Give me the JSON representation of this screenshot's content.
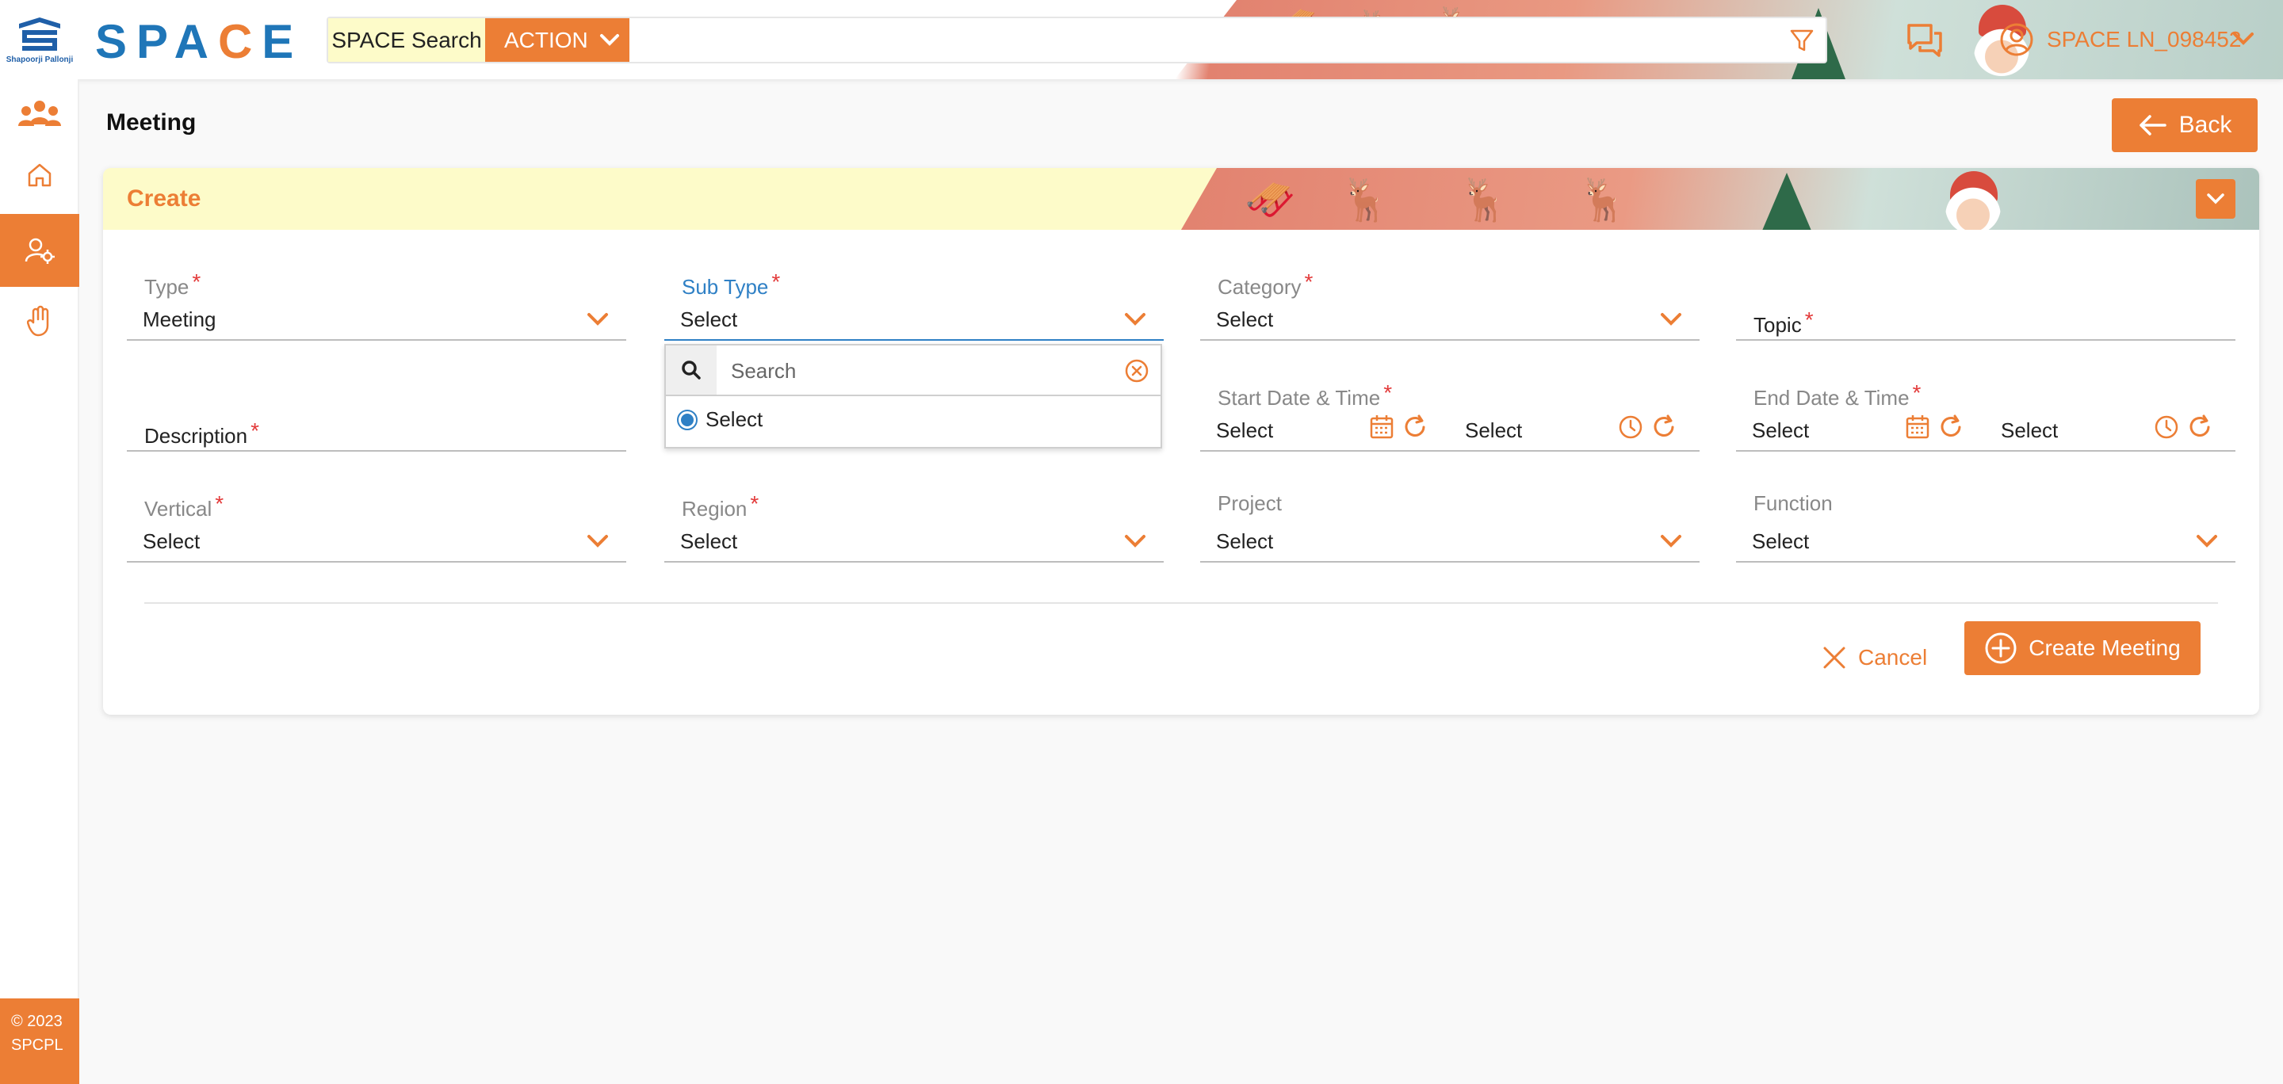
{
  "header": {
    "brand": "SPACE",
    "search_label": "SPACE Search",
    "action_label": "ACTION",
    "search_value": "",
    "user_name": "SPACE LN_098452"
  },
  "sidebar": {
    "items": [
      "group-icon",
      "home-icon",
      "user-settings-icon",
      "hand-icon"
    ],
    "active_index": 2,
    "footer_line1": "© 2023",
    "footer_line2": "SPCPL"
  },
  "page": {
    "title": "Meeting",
    "back_label": "Back"
  },
  "form": {
    "section_title": "Create",
    "type": {
      "label": "Type",
      "value": "Meeting"
    },
    "sub_type": {
      "label": "Sub Type",
      "value": "Select"
    },
    "category": {
      "label": "Category",
      "value": "Select"
    },
    "topic": {
      "label": "Topic"
    },
    "description": {
      "label": "Description"
    },
    "start": {
      "label": "Start Date & Time",
      "date": "Select",
      "time": "Select"
    },
    "end": {
      "label": "End Date & Time",
      "date": "Select",
      "time": "Select"
    },
    "vertical": {
      "label": "Vertical",
      "value": "Select"
    },
    "region": {
      "label": "Region",
      "value": "Select"
    },
    "project": {
      "label": "Project",
      "value": "Select"
    },
    "function": {
      "label": "Function",
      "value": "Select"
    },
    "required_mark": "*"
  },
  "dropdown": {
    "search_placeholder": "Search",
    "option": "Select"
  },
  "actions": {
    "cancel": "Cancel",
    "create": "Create Meeting"
  },
  "colors": {
    "accent": "#ec7e35",
    "brand_blue": "#1f76b8",
    "focus_blue": "#2f80c5",
    "required": "#e33b3b",
    "header_band": "#fdfbc9"
  }
}
